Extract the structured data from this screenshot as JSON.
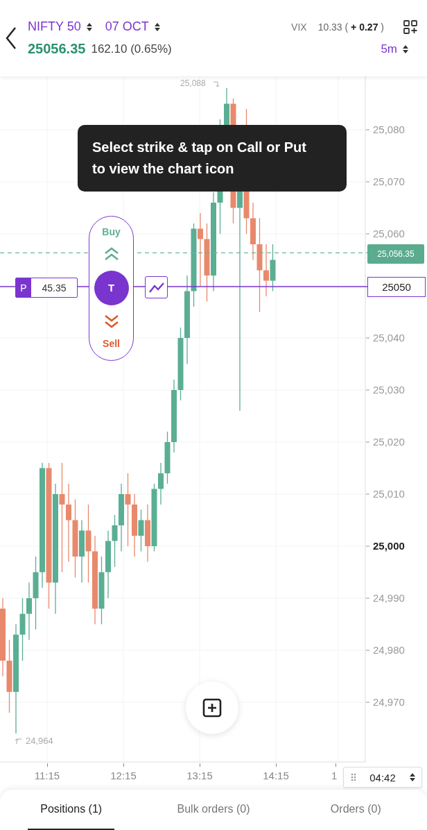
{
  "header": {
    "symbol": "NIFTY 50",
    "expiry": "07 OCT",
    "vix_label": "VIX",
    "vix_value": "10.33 ( **+ 0.27** )",
    "price": "25056.35",
    "change": "162.10 (0.65%)",
    "interval": "5m"
  },
  "chart": {
    "high_label": "25,088",
    "low_label": "24,964",
    "y_ticks": [
      {
        "label": "25,080",
        "bold": false
      },
      {
        "label": "25,070",
        "bold": false
      },
      {
        "label": "25,060",
        "bold": false
      },
      {
        "label": "25,040",
        "bold": false
      },
      {
        "label": "25,030",
        "bold": false
      },
      {
        "label": "25,020",
        "bold": false
      },
      {
        "label": "25,010",
        "bold": false
      },
      {
        "label": "25,000",
        "bold": true
      },
      {
        "label": "24,990",
        "bold": false
      },
      {
        "label": "24,980",
        "bold": false
      },
      {
        "label": "24,970",
        "bold": false
      }
    ],
    "x_ticks": [
      "11:15",
      "12:15",
      "13:15",
      "14:15",
      "1"
    ],
    "last_price": "25,056.35",
    "strike_price": "25050",
    "tooltip": "Select strike & tap on Call or Put to view the chart icon",
    "option": {
      "type": "P",
      "price": "45.35"
    },
    "trade": {
      "buy": "Buy",
      "center": "T",
      "sell": "Sell"
    },
    "time_chip": "04:42"
  },
  "tabs": [
    {
      "label": "Positions (1)",
      "selected": true
    },
    {
      "label": "Bulk orders (0)",
      "selected": false
    },
    {
      "label": "Orders (0)",
      "selected": false
    }
  ]
}
